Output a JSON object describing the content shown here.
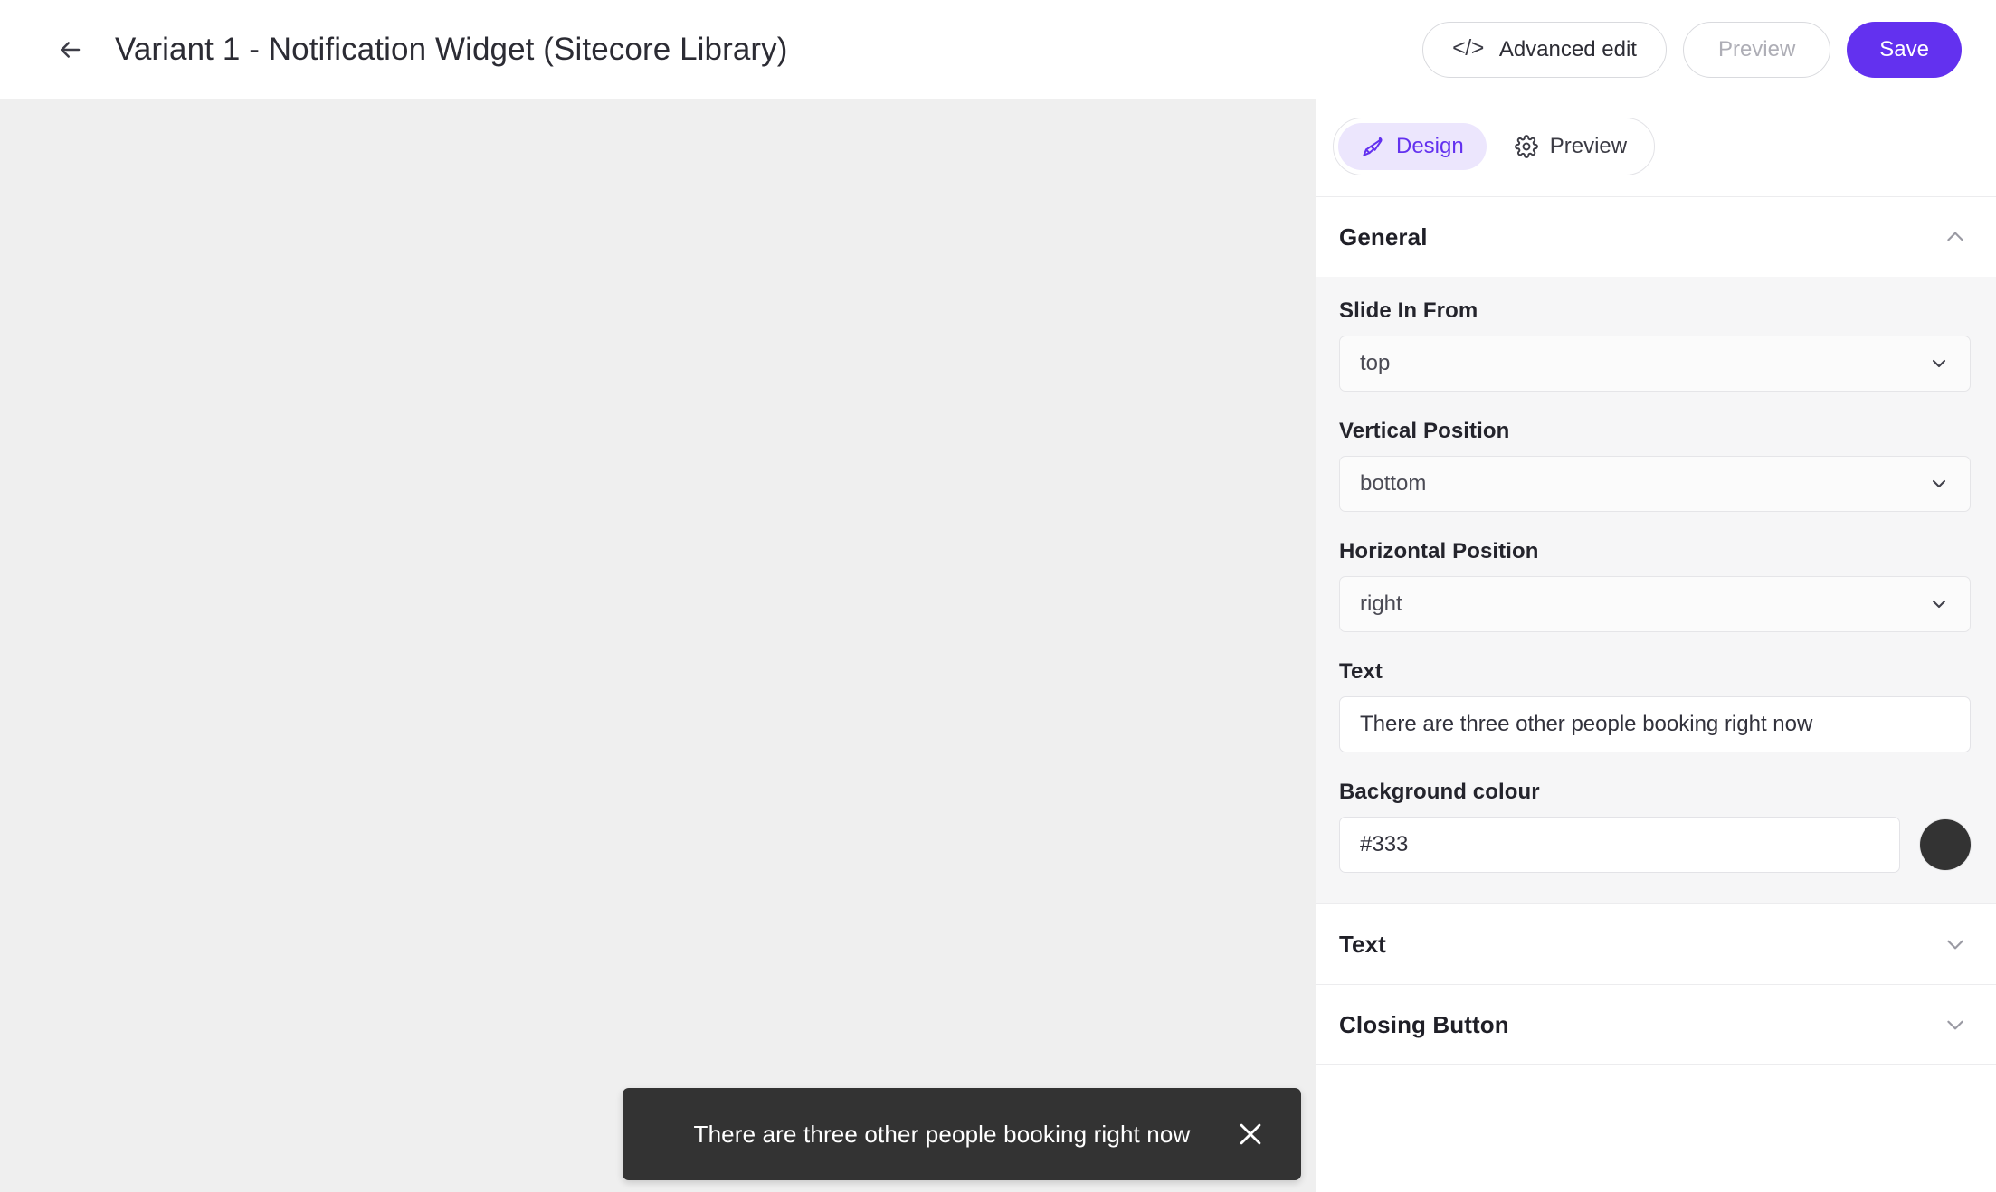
{
  "header": {
    "back_icon": "arrow-left-icon",
    "title": "Variant 1 - Notification Widget (Sitecore Library)",
    "advanced_edit_label": "Advanced edit",
    "advanced_edit_icon": "code-brackets-icon",
    "preview_label": "Preview",
    "save_label": "Save",
    "save_color": "#6331ef"
  },
  "panel": {
    "tabs": [
      {
        "label": "Design",
        "icon": "paintbrush-icon",
        "active": true
      },
      {
        "label": "Preview",
        "icon": "gear-icon",
        "active": false
      }
    ],
    "sections": [
      {
        "title": "General",
        "expanded": true,
        "chevron": "chevron-up-icon",
        "fields": [
          {
            "type": "select",
            "label": "Slide In From",
            "value": "top"
          },
          {
            "type": "select",
            "label": "Vertical Position",
            "value": "bottom"
          },
          {
            "type": "select",
            "label": "Horizontal Position",
            "value": "right"
          },
          {
            "type": "text",
            "label": "Text",
            "value": "There are three other people booking right now",
            "placeholder": ""
          },
          {
            "type": "color",
            "label": "Background colour",
            "value": "#333",
            "swatch": "#333333"
          }
        ]
      },
      {
        "title": "Text",
        "expanded": false,
        "chevron": "chevron-down-icon"
      },
      {
        "title": "Closing Button",
        "expanded": false,
        "chevron": "chevron-down-icon"
      }
    ]
  },
  "canvas": {
    "background": "#efefef",
    "toast": {
      "text": "There are three other people booking right now",
      "background": "#333333",
      "text_color": "#ffffff",
      "close_icon": "close-x-icon"
    }
  }
}
